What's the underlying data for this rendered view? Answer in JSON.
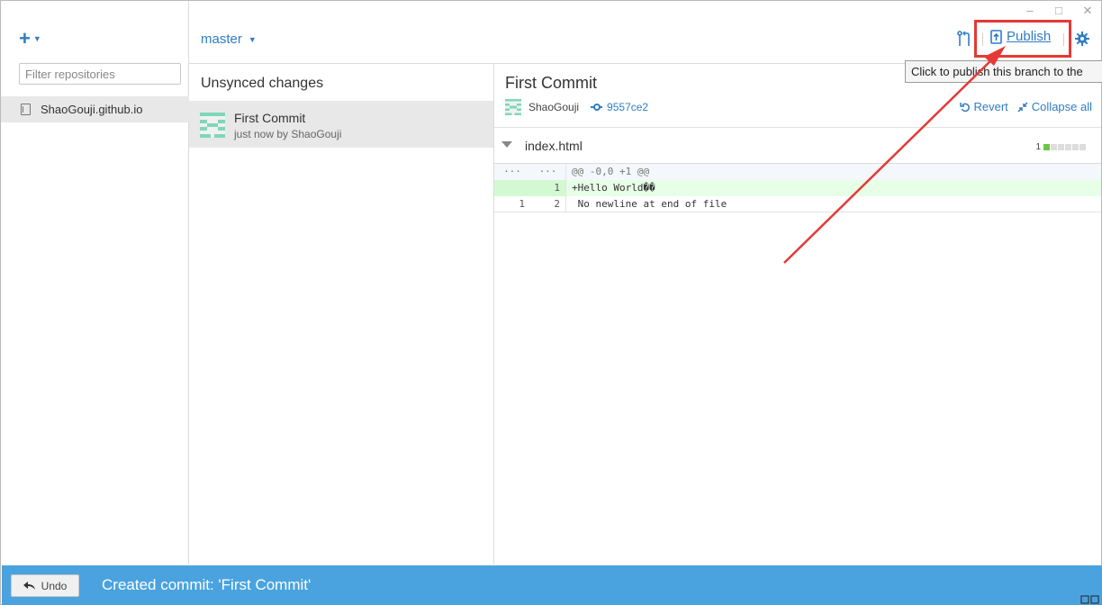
{
  "window": {
    "controls": [
      "–",
      "□",
      "✕"
    ]
  },
  "sidebar": {
    "add_icon": "+",
    "filter_placeholder": "Filter repositories",
    "repos": [
      {
        "name": "ShaoGouji.github.io",
        "icon": "repo-icon"
      }
    ]
  },
  "toolbar": {
    "branch": "master",
    "publish_label": "Publish",
    "publish_tooltip": "Click to publish this branch to the",
    "icons": [
      "pull-request-icon",
      "publish-icon",
      "gear-icon"
    ]
  },
  "commits": {
    "header": "Unsynced changes",
    "items": [
      {
        "title": "First Commit",
        "meta": "just now by ShaoGouji"
      }
    ]
  },
  "details": {
    "title": "First Commit",
    "author": "ShaoGouji",
    "sha": "9557ce2",
    "revert_label": "Revert",
    "collapse_label": "Collapse all",
    "file": {
      "name": "index.html",
      "added_count": "1",
      "stat_blocks_added": 1,
      "stat_blocks_total": 6
    },
    "diff": [
      {
        "type": "hunk",
        "old": "···",
        "new": "···",
        "code": "@@ -0,0 +1 @@"
      },
      {
        "type": "add",
        "old": "",
        "new": "1",
        "code": "+Hello World��"
      },
      {
        "type": "norm",
        "old": "1",
        "new": "2",
        "code": " No newline at end of file"
      }
    ]
  },
  "status": {
    "undo_label": "Undo",
    "message": "Created commit: 'First Commit'"
  },
  "colors": {
    "accent": "#2f7dc4",
    "status_bar": "#4aa3df",
    "highlight": "#e53935",
    "diff_add": "#e6ffe6"
  }
}
